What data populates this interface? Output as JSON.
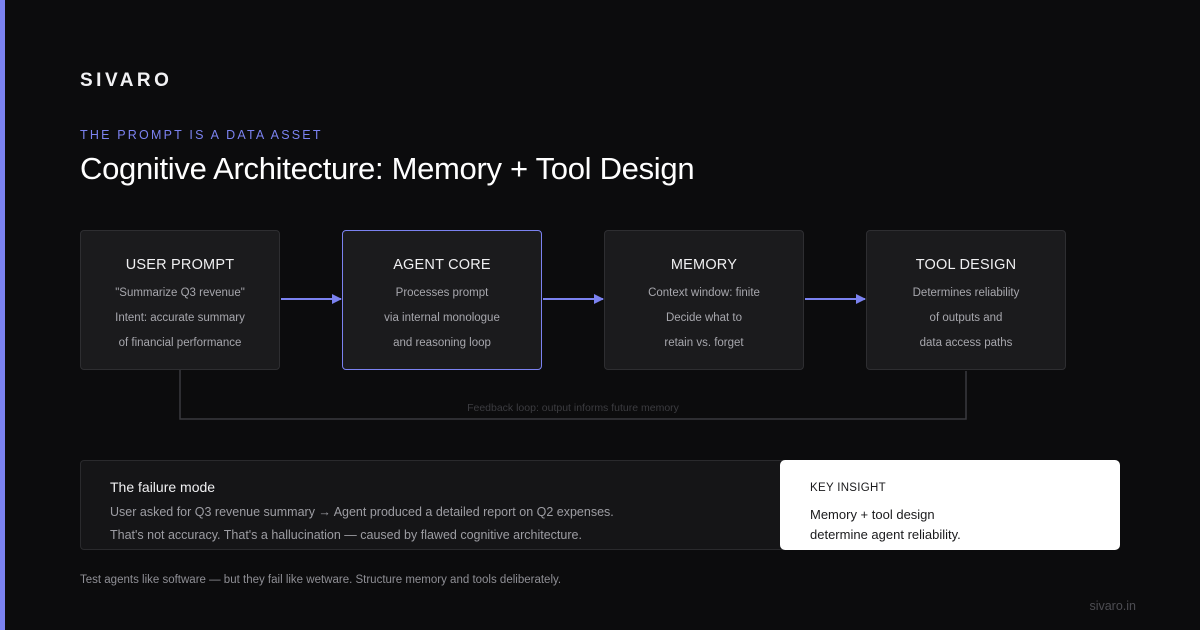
{
  "brand": "SIVARO",
  "eyebrow": "THE PROMPT IS A DATA ASSET",
  "title": "Cognitive Architecture: Memory + Tool Design",
  "colors": {
    "accent": "#7b82f0",
    "background": "#0c0c0d",
    "node_fill": "#1b1b1d",
    "insight_fill": "#ffffff"
  },
  "nodes": [
    {
      "title": "USER PROMPT",
      "lines": [
        "\"Summarize Q3 revenue\"",
        "Intent: accurate summary",
        "of financial performance"
      ],
      "highlighted": false
    },
    {
      "title": "AGENT CORE",
      "lines": [
        "Processes prompt",
        "via internal monologue",
        "and reasoning loop"
      ],
      "highlighted": true
    },
    {
      "title": "MEMORY",
      "lines": [
        "Context window: finite",
        "Decide what to",
        "retain vs. forget"
      ],
      "highlighted": false
    },
    {
      "title": "TOOL DESIGN",
      "lines": [
        "Determines reliability",
        "of outputs and",
        "data access paths"
      ],
      "highlighted": false
    }
  ],
  "feedback_label": "Feedback loop: output informs future memory",
  "failure": {
    "title": "The failure mode",
    "line1": "User asked for Q3 revenue summary → Agent produced a detailed report on Q2 expenses.",
    "line2": "That's not accuracy. That's a hallucination — caused by flawed cognitive architecture."
  },
  "insight": {
    "label": "KEY INSIGHT",
    "line1": "Memory + tool design",
    "line2": "determine agent reliability."
  },
  "footer_note": "Test agents like software — but they fail like wetware. Structure memory and tools deliberately.",
  "site": "sivaro.in"
}
